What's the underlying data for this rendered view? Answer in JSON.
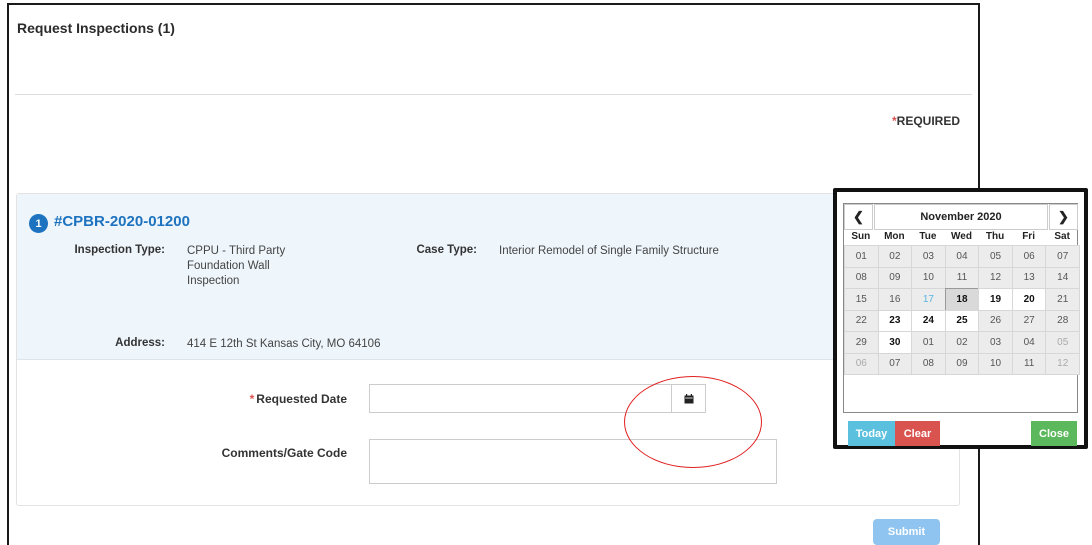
{
  "dialog": {
    "title": "Request Inspections (1)",
    "required_note": "REQUIRED",
    "required_marker": "*"
  },
  "case": {
    "number": "1",
    "id": "#CPBR-2020-01200",
    "inspection_type_label": "Inspection Type:",
    "inspection_type_line1": "CPPU - Third Party",
    "inspection_type_line2": "Foundation Wall",
    "inspection_type_line3": "Inspection",
    "case_type_label": "Case Type:",
    "case_type_value": "Interior Remodel of Single Family Structure",
    "address_label": "Address:",
    "address_value": "414 E 12th St Kansas City, MO 64106"
  },
  "form": {
    "requested_date_label": "Requested Date",
    "requested_date_value": "",
    "comments_label": "Comments/Gate Code",
    "comments_value": "",
    "submit_label": "Submit"
  },
  "datepicker": {
    "month_title": "November 2020",
    "prev_icon": "chevron-left-icon",
    "next_icon": "chevron-right-icon",
    "dow": [
      "Sun",
      "Mon",
      "Tue",
      "Wed",
      "Thu",
      "Fri",
      "Sat"
    ],
    "days": [
      {
        "d": "01",
        "s": "disabled"
      },
      {
        "d": "02",
        "s": "disabled"
      },
      {
        "d": "03",
        "s": "disabled"
      },
      {
        "d": "04",
        "s": "disabled"
      },
      {
        "d": "05",
        "s": "disabled"
      },
      {
        "d": "06",
        "s": "disabled"
      },
      {
        "d": "07",
        "s": "disabled"
      },
      {
        "d": "08",
        "s": "disabled"
      },
      {
        "d": "09",
        "s": "disabled"
      },
      {
        "d": "10",
        "s": "disabled"
      },
      {
        "d": "11",
        "s": "disabled"
      },
      {
        "d": "12",
        "s": "disabled"
      },
      {
        "d": "13",
        "s": "disabled"
      },
      {
        "d": "14",
        "s": "disabled"
      },
      {
        "d": "15",
        "s": "disabled"
      },
      {
        "d": "16",
        "s": "disabled"
      },
      {
        "d": "17",
        "s": "today"
      },
      {
        "d": "18",
        "s": "selected"
      },
      {
        "d": "19",
        "s": "avail"
      },
      {
        "d": "20",
        "s": "avail"
      },
      {
        "d": "21",
        "s": "disabled"
      },
      {
        "d": "22",
        "s": "disabled"
      },
      {
        "d": "23",
        "s": "avail"
      },
      {
        "d": "24",
        "s": "avail"
      },
      {
        "d": "25",
        "s": "avail"
      },
      {
        "d": "26",
        "s": "disabled"
      },
      {
        "d": "27",
        "s": "disabled"
      },
      {
        "d": "28",
        "s": "disabled"
      },
      {
        "d": "29",
        "s": "disabled"
      },
      {
        "d": "30",
        "s": "avail"
      },
      {
        "d": "01",
        "s": "disabled"
      },
      {
        "d": "02",
        "s": "disabled"
      },
      {
        "d": "03",
        "s": "disabled"
      },
      {
        "d": "04",
        "s": "disabled"
      },
      {
        "d": "05",
        "s": "muted"
      },
      {
        "d": "06",
        "s": "muted"
      },
      {
        "d": "07",
        "s": "disabled"
      },
      {
        "d": "08",
        "s": "disabled"
      },
      {
        "d": "09",
        "s": "disabled"
      },
      {
        "d": "10",
        "s": "disabled"
      },
      {
        "d": "11",
        "s": "disabled"
      },
      {
        "d": "12",
        "s": "muted"
      }
    ],
    "today_label": "Today",
    "clear_label": "Clear",
    "close_label": "Close"
  },
  "colors": {
    "link_blue": "#1d73bf",
    "required_red": "#d9534f",
    "annotation_red": "#e02020",
    "today_btn": "#5bc0de",
    "clear_btn": "#d9534f",
    "close_btn": "#5cb85c"
  }
}
